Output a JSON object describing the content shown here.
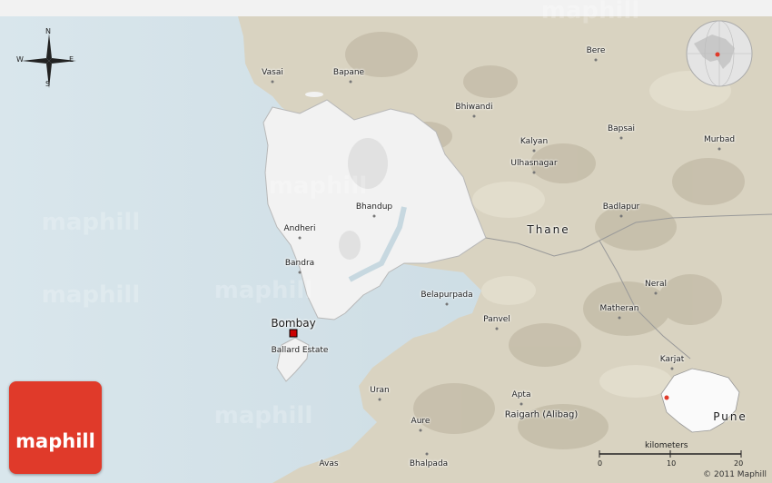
{
  "compass": {
    "n": "N",
    "s": "S",
    "e": "E",
    "w": "W"
  },
  "brand": "maphill",
  "watermark": "maphill",
  "scale": {
    "title": "kilometers",
    "ticks": [
      "0",
      "10",
      "20"
    ]
  },
  "copyright": "© 2011 Maphill",
  "colors": {
    "sea": "#cfdde4",
    "land": "#d8d2c0",
    "highlight": "#f1f1f1",
    "capital": "#cc0000",
    "brand": "#e03a2a"
  },
  "places": {
    "vasai": "Vasai",
    "bapane": "Bapane",
    "bere": "Bere",
    "bhiwandi": "Bhiwandi",
    "bapsai": "Bapsai",
    "kalyan": "Kalyan",
    "murbad": "Murbad",
    "ulhasnagar": "Ulhasnagar",
    "bhandup": "Bhandup",
    "badlapur": "Badlapur",
    "andheri": "Andheri",
    "thane": "Thane",
    "bandra": "Bandra",
    "neral": "Neral",
    "belapurpada": "Belapurpada",
    "matheran": "Matheran",
    "panvel": "Panvel",
    "bombay": "Bombay",
    "ballard": "Ballard Estate",
    "karjat": "Karjat",
    "uran": "Uran",
    "apta": "Apta",
    "raigarh": "Raigarh (Alibag)",
    "pune": "Pune",
    "aure": "Aure",
    "avas": "Avas",
    "bhalpada": "Bhalpada"
  }
}
